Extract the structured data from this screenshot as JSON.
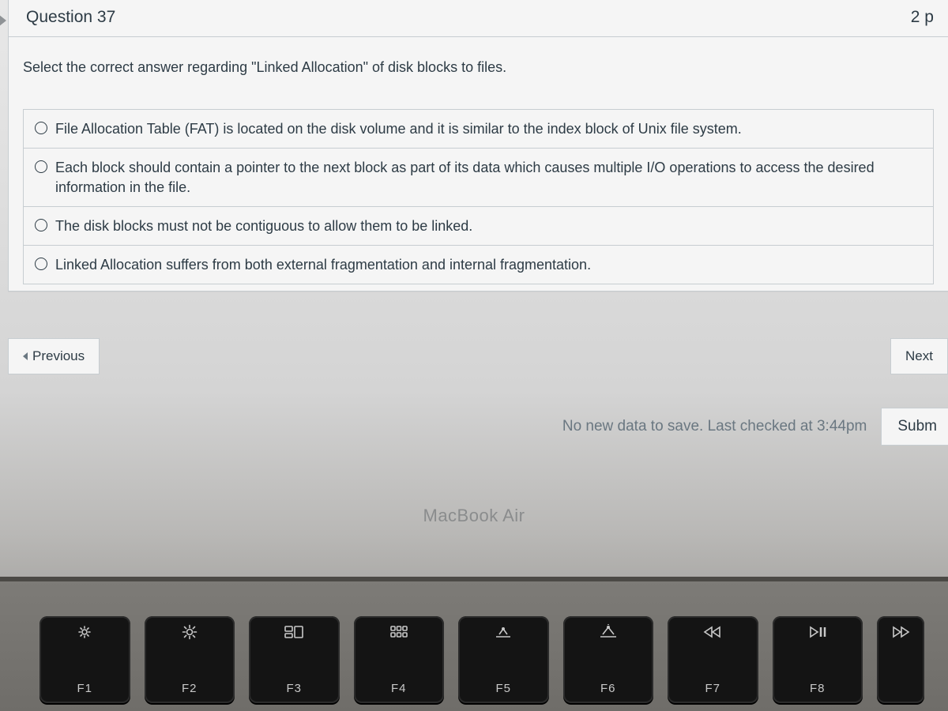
{
  "header": {
    "question_label": "Question 37",
    "points_label": "2 p"
  },
  "prompt": "Select the correct answer regarding \"Linked Allocation\" of disk blocks to files.",
  "options": [
    "File Allocation Table (FAT) is located on the disk volume and it is similar to the index block of Unix file system.",
    "Each block should contain a pointer to the next block as part of its data which causes multiple I/O operations to access the desired information in the file.",
    "The disk blocks must not be contiguous to allow them to be linked.",
    "Linked Allocation suffers from both external fragmentation and internal fragmentation."
  ],
  "nav": {
    "previous_label": "Previous",
    "next_label": "Next"
  },
  "status": {
    "save_text": "No new data to save. Last checked at 3:44pm",
    "submit_label": "Subm"
  },
  "laptop": {
    "brand_label": "MacBook Air",
    "keys": [
      {
        "fn": "F1",
        "icon": "brightness-down-icon"
      },
      {
        "fn": "F2",
        "icon": "brightness-up-icon"
      },
      {
        "fn": "F3",
        "icon": "mission-control-icon"
      },
      {
        "fn": "F4",
        "icon": "launchpad-icon"
      },
      {
        "fn": "F5",
        "icon": "keyboard-dim-icon"
      },
      {
        "fn": "F6",
        "icon": "keyboard-bright-icon"
      },
      {
        "fn": "F7",
        "icon": "rewind-icon"
      },
      {
        "fn": "F8",
        "icon": "play-pause-icon"
      },
      {
        "fn": "",
        "icon": "forward-icon"
      }
    ]
  }
}
